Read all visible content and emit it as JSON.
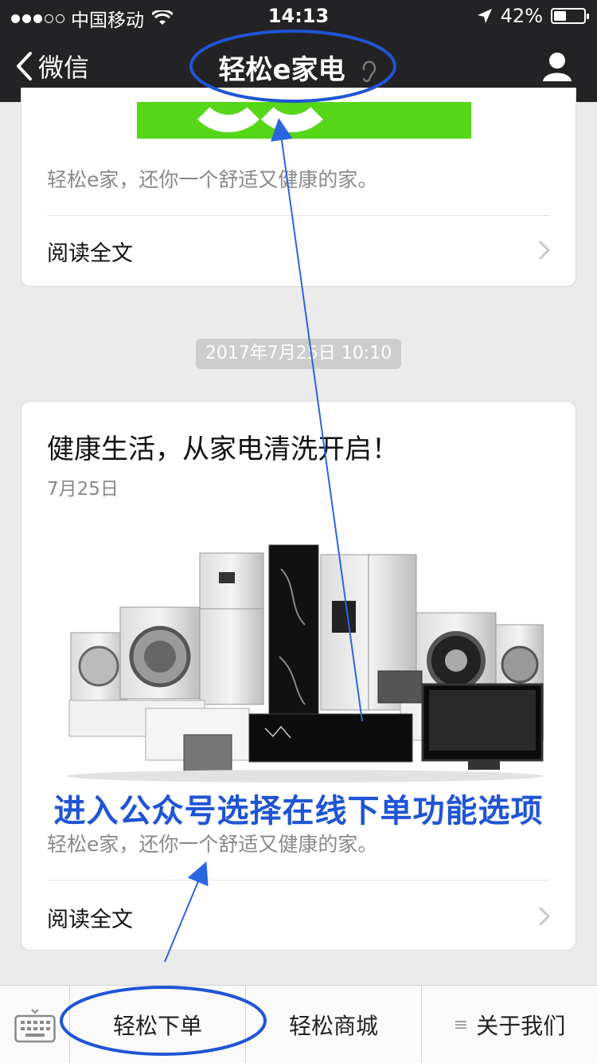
{
  "status_bar": {
    "carrier": "中国移动",
    "time": "14:13",
    "battery_text": "42%",
    "battery_level": 0.42
  },
  "nav": {
    "back_label": "微信",
    "title": "轻松e家电"
  },
  "article_prev": {
    "summary": "轻松e家，还你一个舒适又健康的家。",
    "read_all": "阅读全文"
  },
  "timestamp": "2017年7月25日 10:10",
  "article": {
    "title": "健康生活，从家电清洗开启！",
    "date": "7月25日",
    "summary": "轻松e家，还你一个舒适又健康的家。",
    "read_all": "阅读全文"
  },
  "annotation_text": "进入公众号选择在线下单功能选项",
  "menu": {
    "items": [
      {
        "label": "轻松下单"
      },
      {
        "label": "轻松商城"
      },
      {
        "label": "关于我们"
      }
    ],
    "submenu_marker": "≡"
  },
  "colors": {
    "header_bg": "#232325",
    "annotation_blue": "#1f55d4",
    "accent_green": "#56d718"
  }
}
